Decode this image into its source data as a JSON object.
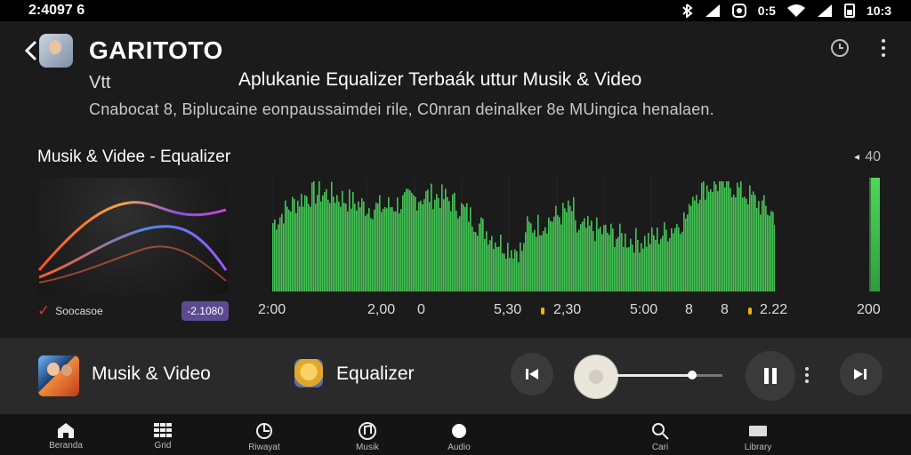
{
  "status_bar": {
    "time": "2:4097 6",
    "right_text_1": "0:5",
    "right_text_2": "10:3"
  },
  "app": {
    "title": "GARITOTO",
    "subtitle_small": "Vtt",
    "headline": "Aplukanie Equalizer Terbaák uttur Musik & Video",
    "description": "Cnabocat 8,  Biplucaine eonpaussaimdei rile, C0nran deinalker 8e MUingica henalaen.",
    "section_label": "Musik & Videe - Equalizer",
    "right_label": "40",
    "source_label": "Soocasoe",
    "time_pill": "-2.1080",
    "axis_labels": [
      "2:00",
      "2,00",
      "0",
      "5,30",
      "2,30",
      "5:00",
      "8",
      "8",
      "2.22",
      "200"
    ]
  },
  "player": {
    "left_title": "Musik & Video",
    "center_title": "Equalizer",
    "progress": 0.73
  },
  "nav": {
    "items": [
      {
        "label": "Beranda",
        "icon": "home-icon"
      },
      {
        "label": "Grid",
        "icon": "grid-icon"
      },
      {
        "label": "Riwayat",
        "icon": "history-icon"
      },
      {
        "label": "Musik",
        "icon": "music-icon"
      },
      {
        "label": "Audio",
        "icon": "circle-icon"
      },
      {
        "label": "Cari",
        "icon": "search-icon"
      },
      {
        "label": "Library",
        "icon": "library-icon"
      }
    ]
  },
  "colors": {
    "green": "#48d45a",
    "purple": "#5c4b91",
    "accent": "#f0b300"
  }
}
